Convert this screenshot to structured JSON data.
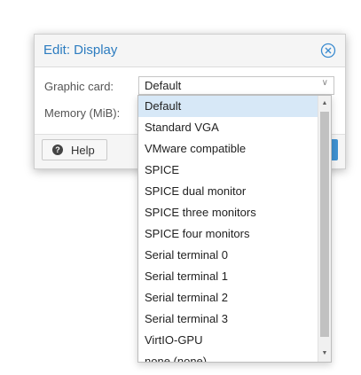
{
  "dialog": {
    "title": "Edit: Display",
    "close_icon": "close-circle-icon"
  },
  "form": {
    "graphic_card_label": "Graphic card:",
    "graphic_card_value": "Default",
    "memory_label": "Memory (MiB):"
  },
  "footer": {
    "help_label": "Help",
    "help_icon": "question-circle-icon"
  },
  "dropdown": {
    "selected_index": 0,
    "options": [
      "Default",
      "Standard VGA",
      "VMware compatible",
      "SPICE",
      "SPICE dual monitor",
      "SPICE three monitors",
      "SPICE four monitors",
      "Serial terminal 0",
      "Serial terminal 1",
      "Serial terminal 2",
      "Serial terminal 3",
      "VirtIO-GPU",
      "none (none)"
    ]
  },
  "colors": {
    "title": "#2c7cc0",
    "selected_option": "#d7e8f7",
    "primary_button": "#3f92d2"
  }
}
